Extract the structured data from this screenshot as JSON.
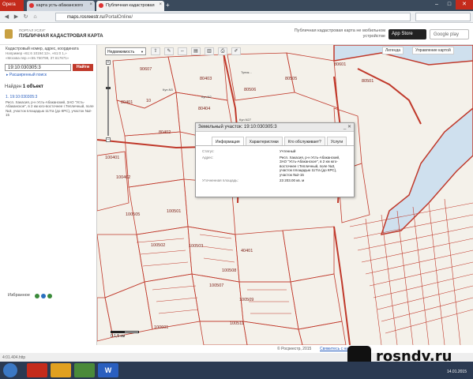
{
  "browser": {
    "menu_label": "Opera",
    "tabs": [
      {
        "label": "карта усть-абаканского"
      },
      {
        "label": "Публичная кадастровая"
      }
    ],
    "url_host": "maps.rosreestr.ru",
    "url_path": "/PortalOnline/",
    "window_buttons": [
      "–",
      "□",
      "✕"
    ]
  },
  "header": {
    "portal_sub": "ПОРТАЛ УСЛУГ",
    "portal_title": "ПУБЛИЧНАЯ КАДАСТРОВАЯ КАРТА",
    "mobile_title": "Публичная кадастровая карта не мобильном устройстве",
    "app_store": "App Store",
    "google_play": "Google play"
  },
  "left_panel": {
    "hint_lead": "Кадастровый номер, адрес, координата",
    "hint_lines": [
      "Например «61:6 10194:12», «61:0 1,»",
      "«Москва пер.»«55.750798, 37.617671»"
    ],
    "search_value": "19:10:030305:3",
    "search_button": "Найти",
    "extended_search": "▸ Расширенный поиск",
    "found_prefix": "Найден",
    "found_count": "1 объект",
    "result_number": "1. 19:10:030305:3",
    "result_text": "Респ. Хакасия, р-н Усть-Абаканский, ЗАО \"Усть-Абаканское\", в 2 км юго-восточнее г.Тепличный, поле №3, участок площадью 117га (до КРС), участок №2-15",
    "favorites": "Избранное"
  },
  "toolbar": {
    "layer_select": "Недвижимость",
    "tools": [
      "⇧",
      "✎",
      "⇔",
      "▤",
      "▥",
      "⎙",
      "✐"
    ],
    "legend": "Легенда",
    "map_management": "Управление картой"
  },
  "popup": {
    "title": "Земельный участок: 19:10:030305:3",
    "controls": "_ ✕",
    "tabs": [
      "Информация",
      "Характеристики",
      "Кто обслуживает?",
      "Услуги"
    ],
    "rows": [
      {
        "k": "Статус:",
        "v": "Учтенный"
      },
      {
        "k": "Адрес:",
        "v": "Респ. Хакасия, р-н Усть-Абаканский, ЗАО \"Усть-Абаканское\", в 2 км юго-восточнее г.Тепличный, поле №3, участок площадью 117га (до КРС), участок №2-15"
      },
      {
        "k": "Уточненная площадь:",
        "v": "23 203.00 кв. м"
      }
    ]
  },
  "map": {
    "parcel_labels": [
      "90607",
      "80401",
      "10",
      "80404",
      "80403",
      "80505",
      "80506",
      "80601",
      "80501",
      "80402",
      "100401",
      "100402",
      "100501",
      "100502",
      "100503",
      "40401",
      "100508",
      "100507",
      "100509",
      "100511",
      "100601",
      "100505"
    ],
    "road_labels": [
      "Тупик...",
      "Куп.N3",
      "Куп.N2",
      "Куп.N27"
    ],
    "scale_label": "0  1,5 км"
  },
  "footer": {
    "copyright": "© Росреестр, 2015",
    "feedback": "Свяжитесь с нами"
  },
  "status": {
    "left_text": "4:01.404.http"
  },
  "taskbar": {
    "apps": [
      "",
      "",
      "",
      "W"
    ],
    "clock": "14.01.2015"
  },
  "watermark": {
    "text": "rosndv.ru"
  },
  "colors": {
    "parcel_line": "#c0392b",
    "river": "#cfe0ee",
    "map_bg": "#f4f1ea",
    "accent_red": "#c0392b"
  }
}
